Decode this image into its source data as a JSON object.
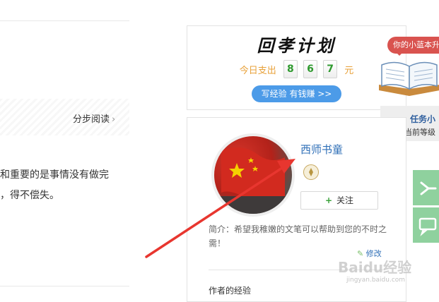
{
  "article": {
    "step_read_label": "分步阅读",
    "chevron": "›",
    "line1": "和重要的是事情没有做完",
    "line2": "，得不偿失。"
  },
  "plan_card": {
    "title": "回孝计划",
    "today_label": "今日支出",
    "digits": [
      "8",
      "6",
      "7"
    ],
    "unit": "元",
    "write_button": "写经验 有钱赚 >>"
  },
  "helper": {
    "bubble": "你的小蓝本升",
    "task_title": "任务小",
    "task_level": "当前等级"
  },
  "author": {
    "name": "西师书童",
    "follow_label": "关注",
    "follow_plus": "+",
    "intro": "简介：希望我稚嫩的文笔可以帮助到您的不时之需！",
    "modify_label": "修改",
    "experience_label": "作者的经验"
  },
  "watermark": {
    "main": "Baidu经验",
    "sub": "jingyan.baidu.com"
  },
  "colors": {
    "arrow": "#e8362f",
    "link": "#2f6fb7",
    "accent_orange": "#e8a13a",
    "button_blue": "#4c9be8"
  }
}
